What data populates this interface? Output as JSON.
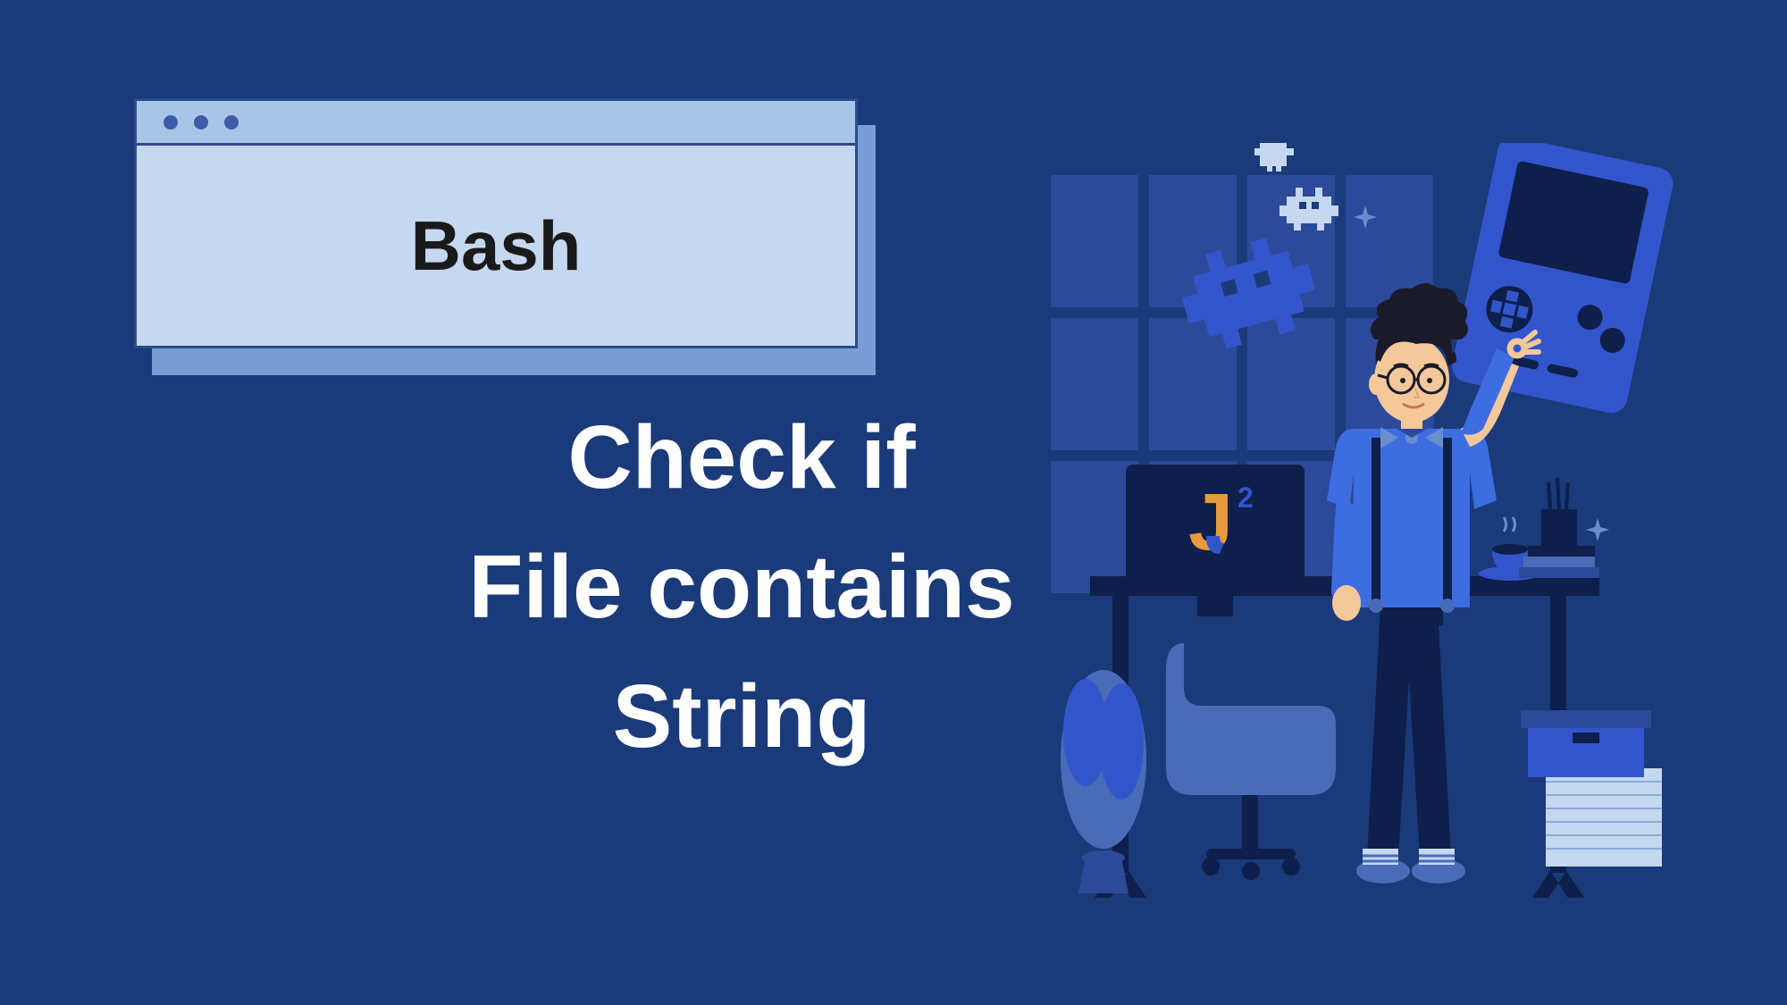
{
  "window": {
    "title": "Bash"
  },
  "heading": {
    "line1": "Check if",
    "line2": "File contains",
    "line3": "String"
  },
  "monitor": {
    "logo_text": "J",
    "logo_superscript": "2"
  }
}
